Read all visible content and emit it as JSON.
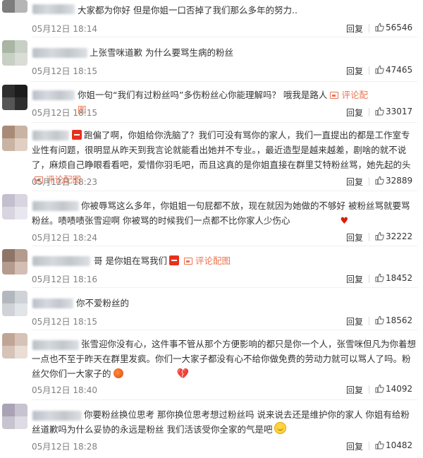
{
  "reply_label": "回复",
  "link_label": "评论配图",
  "colors": {
    "link": "#eb7350",
    "meta": "#808080",
    "text": "#333333"
  },
  "comments": [
    {
      "text": "大家都为你好 但是你姐一口否掉了我们那么多年的努力..",
      "date": "05月12日",
      "time": "18:14",
      "likes": "56546"
    },
    {
      "text": "上张雪咪道歉 为什么要骂生病的粉丝",
      "date": "05月12日",
      "time": "18:15",
      "likes": "47465"
    },
    {
      "text": "你姐一句“我们有过粉丝吗”多伤粉丝心你能理解吗？ 哦我是路人",
      "date": "05月12日",
      "time": "18:15",
      "likes": "33017"
    },
    {
      "text_a": "跑偏了啊，你姐给你洗脑了？我们可没有骂你的家人，我们一直提出的都是工作室专业性有问题，很明显从昨天到我言论就能看出她并不专业。，最近造型是越来越差，剧啥的就不说了，麻烦自己睁眼看看吧，爱惜你羽毛吧，而且这真的是你姐直接在群里艾特粉丝骂，她先起的头",
      "date": "05月12日",
      "time": "18:23",
      "likes": "32889"
    },
    {
      "text": "你被辱骂这么多年，你姐姐一句屁都不放，现在就因为她做的不够好 被粉丝骂就要骂粉丝。啧啧啧张雪迎啊 你被骂的时候我们一点都不比你家人少伤心",
      "date": "05月12日",
      "time": "18:24",
      "likes": "32222"
    },
    {
      "text": "哥 是你姐在骂我们",
      "date": "05月12日",
      "time": "18:16",
      "likes": "18452"
    },
    {
      "text": "你不爱粉丝的",
      "date": "05月12日",
      "time": "18:15",
      "likes": "18562"
    },
    {
      "text": "张雪迎你没有心，这件事不管从那个方便影响的都只是你一个人，张雪咪但凡为你着想一点也不至于昨天在群里发疯。你们一大家子都没有心不给你做免费的劳动力就可以骂人了吗。粉丝欠你们一大家子的",
      "date": "05月12日",
      "time": "18:40",
      "likes": "14092"
    },
    {
      "text": "你要粉丝换位思考 那你换位思考想过粉丝吗 说来说去还是维护你的家人 你姐有给粉丝道歉吗为什么妥协的永远是粉丝 我们活该受你全家的气是吧",
      "date": "05月12日",
      "time": "18:28",
      "likes": "10482"
    }
  ]
}
